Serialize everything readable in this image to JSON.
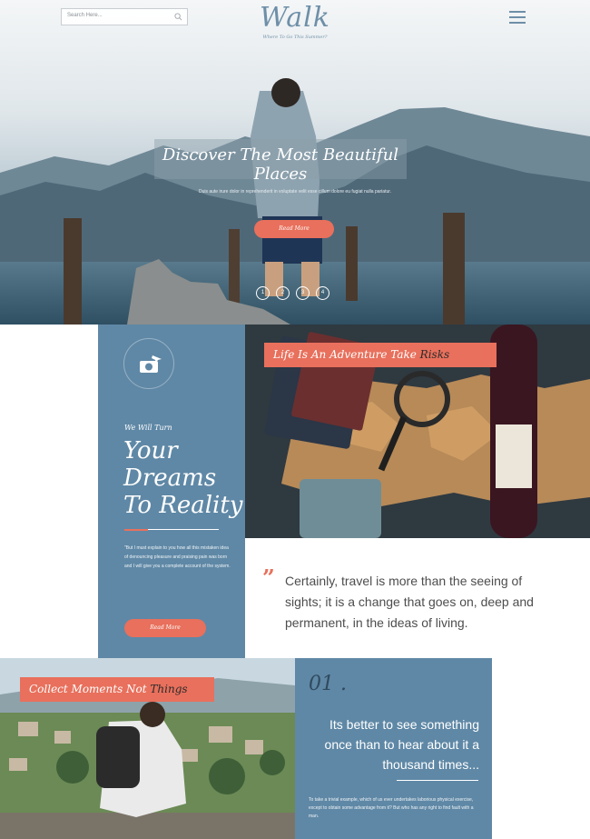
{
  "header": {
    "search_placeholder": "Search Here...",
    "logo_title": "Walk",
    "logo_tagline": "Where To Go This Summer?"
  },
  "hero": {
    "title": "Discover The Most Beautiful Places",
    "text": "Duis aute irure dolor in reprehenderit in voluptate velit esse cillum dolore eu fugiat nulla pariatur.",
    "button": "Read More",
    "dots": [
      "1",
      "2",
      "3",
      "4"
    ]
  },
  "adventure": {
    "banner_main": "Life Is An Adventure Take ",
    "banner_accent": "Risks"
  },
  "dreams": {
    "kicker": "We Will Turn",
    "line1": "Your",
    "line2": "Dreams",
    "line3": "To Reality",
    "text": "\"But I must explain to you how all this mistaken idea of denouncing pleasure and praising pain was born and I will give you a complete account of the system.",
    "button": "Read More"
  },
  "quote": {
    "mark": "”",
    "text": "Certainly, travel is more than the seeing of sights; it is a change that goes on, deep and permanent, in the ideas of living."
  },
  "moments": {
    "banner_main": "Collect Moments Not ",
    "banner_accent": "Things"
  },
  "card": {
    "number": "01 .",
    "text": "Its better to see something once than to hear about it a thousand times...",
    "small": "To take a trivial example, which of us ever undertakes laborious physical exercise, except to obtain some advantage from it? But who has any right to find fault with a man."
  },
  "colors": {
    "accent": "#e8705c",
    "blue": "#5f88a6",
    "logo": "#6e8fa8"
  }
}
